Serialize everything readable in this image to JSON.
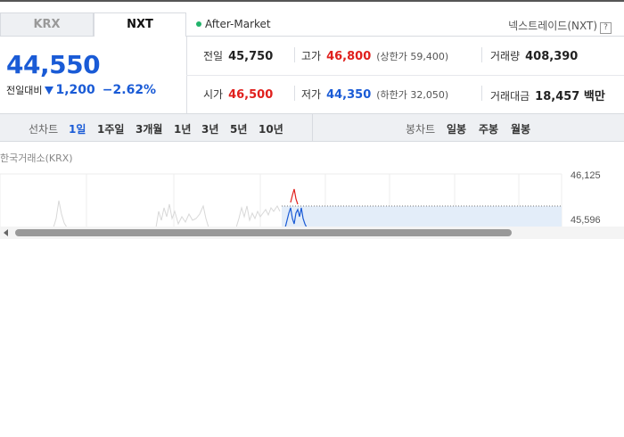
{
  "tabs": {
    "krx": "KRX",
    "nxt": "NXT"
  },
  "after_market": "After-Market",
  "nxt_label": "넥스트레이드(NXT)",
  "help": "?",
  "price": {
    "current": "44,550",
    "change_label": "전일대비",
    "change": "1,200",
    "change_pct": "−2.62%"
  },
  "stats": {
    "prev_close": {
      "label": "전일",
      "value": "45,750"
    },
    "high": {
      "label": "고가",
      "value": "46,800",
      "limit_label": "(상한가 59,400)"
    },
    "volume": {
      "label": "거래량",
      "value": "408,390"
    },
    "open": {
      "label": "시가",
      "value": "46,500"
    },
    "low": {
      "label": "저가",
      "value": "44,350",
      "limit_label": "(하한가 32,050)"
    },
    "amount": {
      "label": "거래대금",
      "value": "18,457 백만"
    }
  },
  "chart_controls": {
    "line_title": "선차트",
    "line_periods": [
      "1일",
      "1주일",
      "3개월",
      "1년",
      "3년",
      "5년",
      "10년"
    ],
    "candle_title": "봉차트",
    "candle_periods": [
      "일봉",
      "주봉",
      "월봉"
    ]
  },
  "exchange_label": "한국거래소(KRX)",
  "chart_axis": {
    "top": "46,125",
    "mid": "45,596"
  },
  "colors": {
    "up": "#e0201d",
    "down": "#1a5bd6",
    "accent": "#21b36b"
  }
}
